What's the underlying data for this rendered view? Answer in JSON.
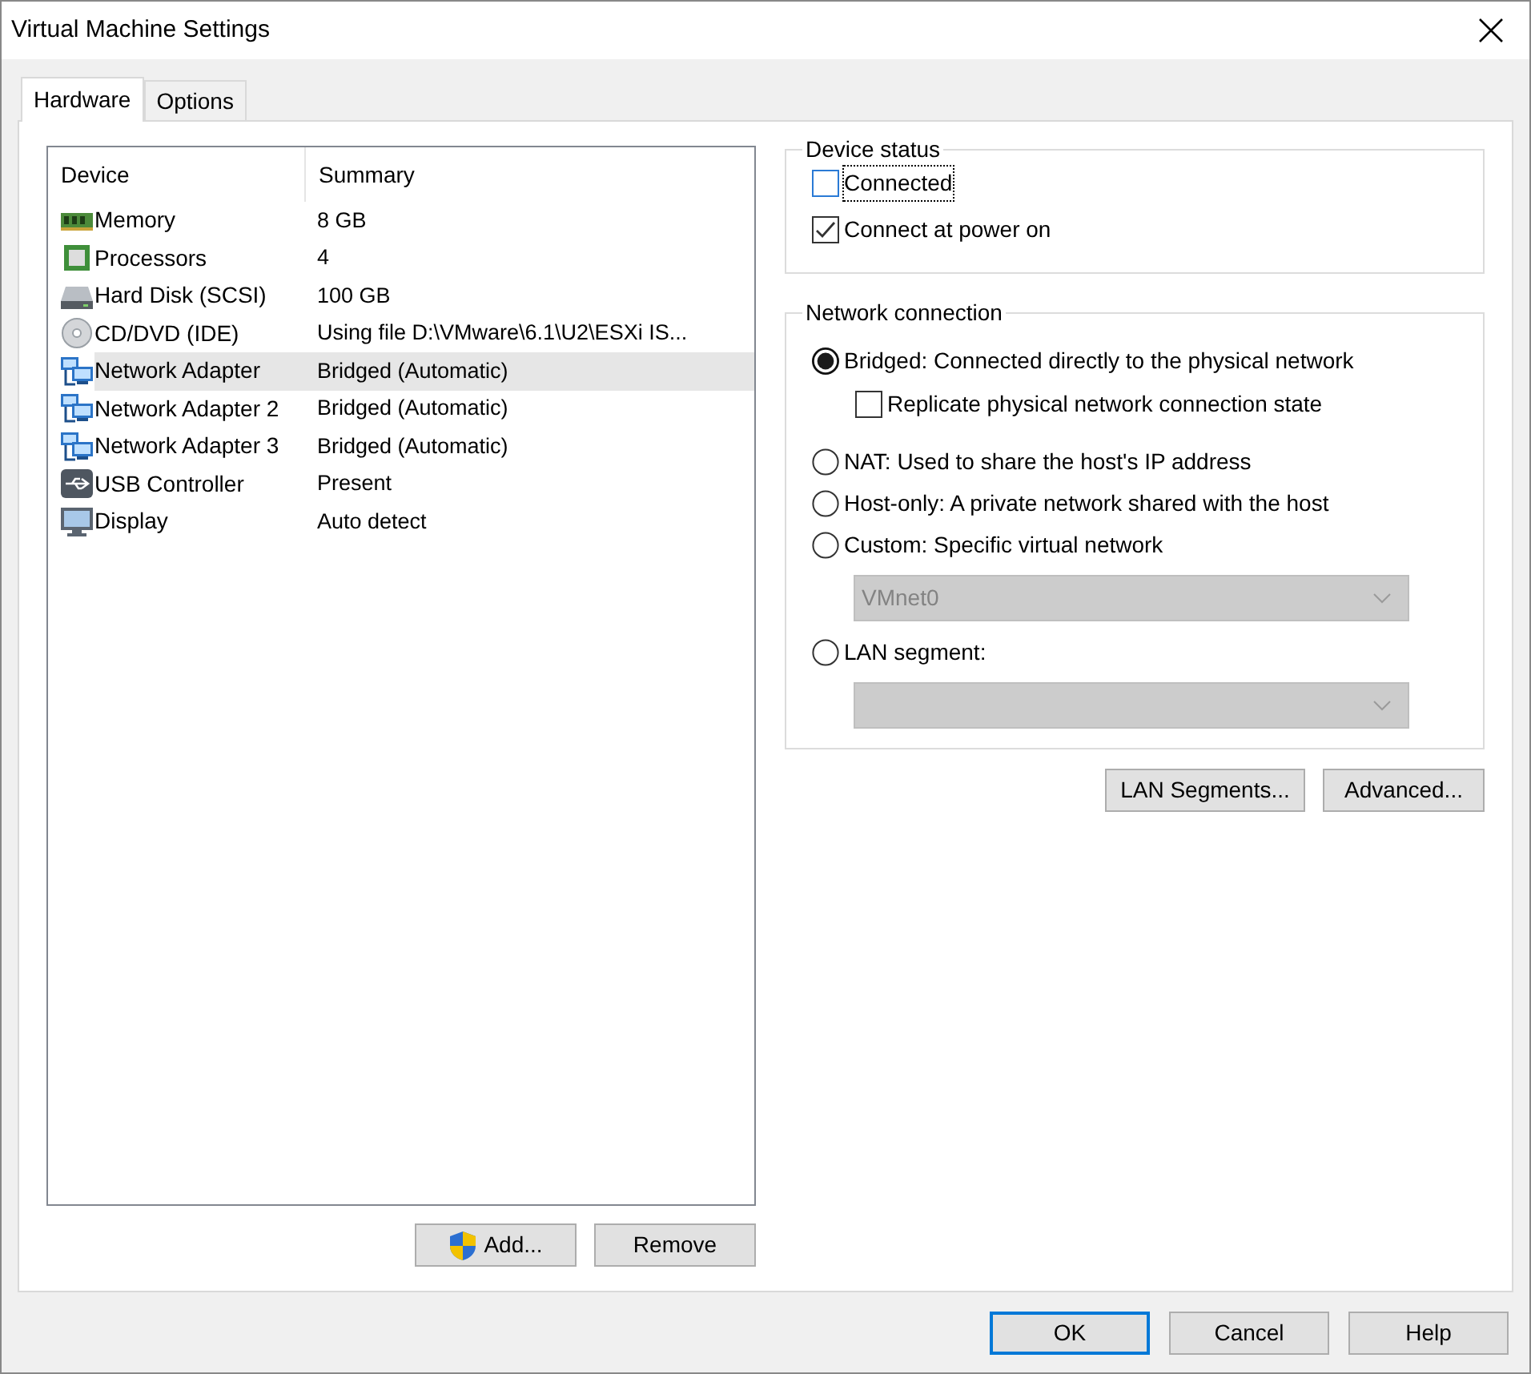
{
  "window": {
    "title": "Virtual Machine Settings"
  },
  "tabs": [
    {
      "label": "Hardware",
      "selected": true
    },
    {
      "label": "Options",
      "selected": false
    }
  ],
  "device_table": {
    "columns": [
      "Device",
      "Summary"
    ],
    "rows": [
      {
        "kind": "memory",
        "device": "Memory",
        "summary": "8 GB",
        "selected": false
      },
      {
        "kind": "cpu",
        "device": "Processors",
        "summary": "4",
        "selected": false
      },
      {
        "kind": "disk",
        "device": "Hard Disk (SCSI)",
        "summary": "100 GB",
        "selected": false
      },
      {
        "kind": "cd",
        "device": "CD/DVD (IDE)",
        "summary": "Using file D:\\VMware\\6.1\\U2\\ESXi IS...",
        "selected": false
      },
      {
        "kind": "network",
        "device": "Network Adapter",
        "summary": "Bridged (Automatic)",
        "selected": true
      },
      {
        "kind": "network",
        "device": "Network Adapter 2",
        "summary": "Bridged (Automatic)",
        "selected": false
      },
      {
        "kind": "network",
        "device": "Network Adapter 3",
        "summary": "Bridged (Automatic)",
        "selected": false
      },
      {
        "kind": "usb",
        "device": "USB Controller",
        "summary": "Present",
        "selected": false
      },
      {
        "kind": "display",
        "device": "Display",
        "summary": "Auto detect",
        "selected": false
      }
    ]
  },
  "list_buttons": [
    {
      "label": "Add...",
      "shield": true
    },
    {
      "label": "Remove",
      "shield": false
    }
  ],
  "device_status": {
    "title": "Device status",
    "checkboxes": [
      {
        "label": "Connected",
        "checked": false,
        "focused": true
      },
      {
        "label": "Connect at power on",
        "checked": true,
        "focused": false
      }
    ]
  },
  "network_connection": {
    "title": "Network connection",
    "options": [
      {
        "label": "Bridged: Connected directly to the physical network",
        "selected": true,
        "sub_checkbox": {
          "label": "Replicate physical network connection state",
          "checked": false
        }
      },
      {
        "label": "NAT: Used to share the host's IP address",
        "selected": false
      },
      {
        "label": "Host-only: A private network shared with the host",
        "selected": false
      },
      {
        "label": "Custom: Specific virtual network",
        "selected": false,
        "dropdown": {
          "value": "VMnet0",
          "disabled": true
        }
      },
      {
        "label": "LAN segment:",
        "selected": false,
        "dropdown": {
          "disabled": true
        }
      }
    ]
  },
  "network_buttons": [
    "LAN Segments...",
    "Advanced..."
  ],
  "dialog_buttons": [
    {
      "label": "OK",
      "default": true
    },
    {
      "label": "Cancel",
      "default": false
    },
    {
      "label": "Help",
      "default": false
    }
  ]
}
